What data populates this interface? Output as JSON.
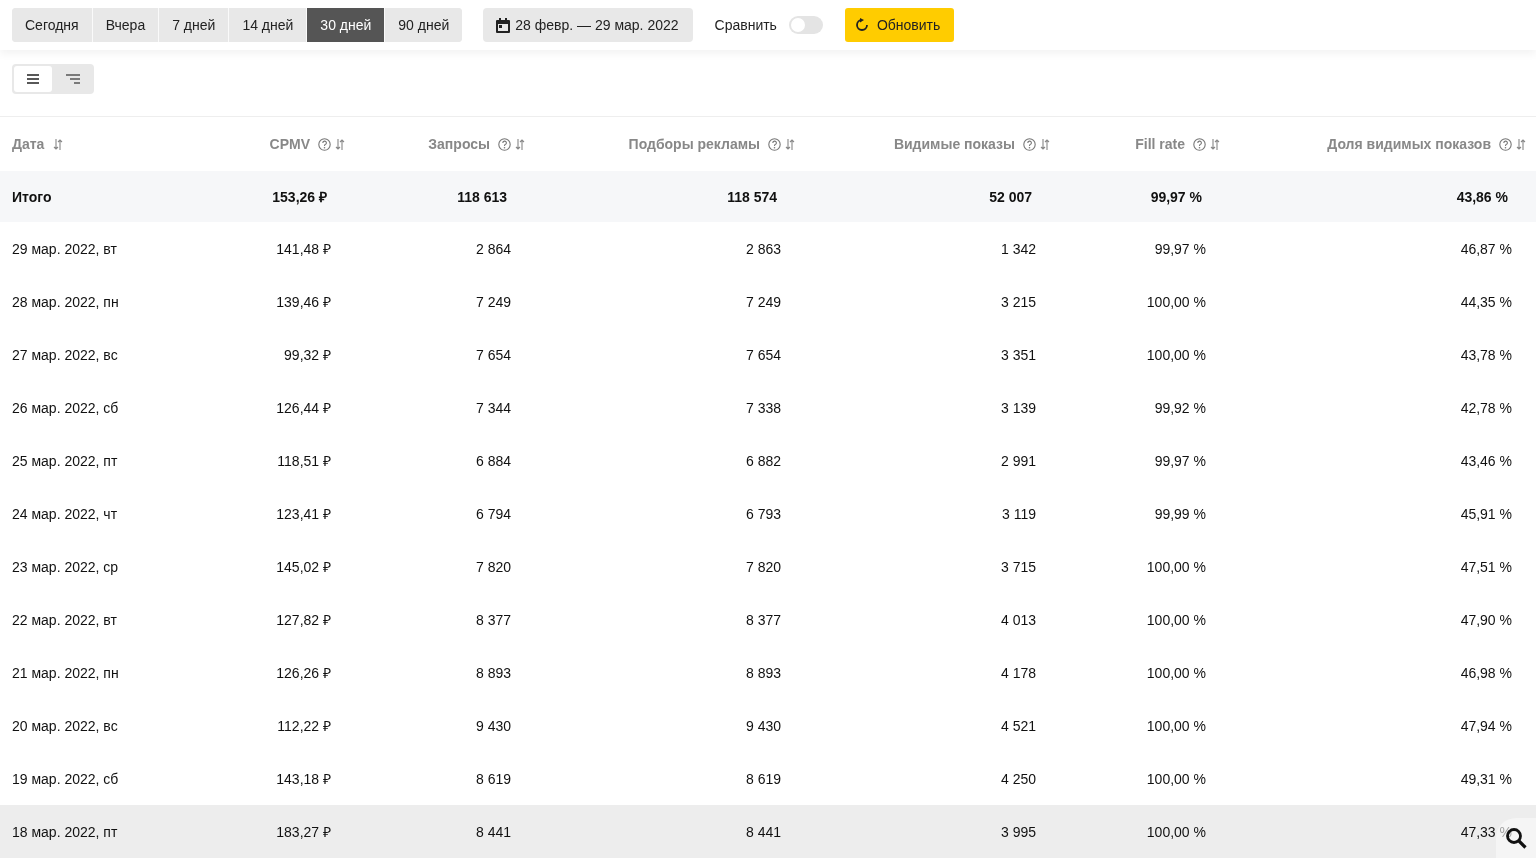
{
  "periods": [
    {
      "label": "Сегодня",
      "selected": false
    },
    {
      "label": "Вчера",
      "selected": false
    },
    {
      "label": "7 дней",
      "selected": false
    },
    {
      "label": "14 дней",
      "selected": false
    },
    {
      "label": "30 дней",
      "selected": true
    },
    {
      "label": "90 дней",
      "selected": false
    }
  ],
  "date_range": "28 февр. — 29 мар. 2022",
  "compare": {
    "label": "Сравнить",
    "on": false
  },
  "refresh_button": "Обновить",
  "view_toggle": [
    {
      "kind": "list",
      "selected": true
    },
    {
      "kind": "tree",
      "selected": false
    }
  ],
  "table": {
    "columns": [
      {
        "label": "Дата",
        "help": false
      },
      {
        "label": "CPMV",
        "help": true
      },
      {
        "label": "Запросы",
        "help": true
      },
      {
        "label": "Подборы рекламы",
        "help": true
      },
      {
        "label": "Видимые показы",
        "help": true
      },
      {
        "label": "Fill rate",
        "help": true
      },
      {
        "label": "Доля видимых показов",
        "help": true
      }
    ],
    "total": [
      "Итого",
      "153,26 ₽",
      "118 613",
      "118 574",
      "52 007",
      "99,97 %",
      "43,86 %"
    ],
    "rows": [
      {
        "selected": false,
        "cells": [
          "29 мар. 2022, вт",
          "141,48 ₽",
          "2 864",
          "2 863",
          "1 342",
          "99,97 %",
          "46,87 %"
        ]
      },
      {
        "selected": false,
        "cells": [
          "28 мар. 2022, пн",
          "139,46 ₽",
          "7 249",
          "7 249",
          "3 215",
          "100,00 %",
          "44,35 %"
        ]
      },
      {
        "selected": false,
        "cells": [
          "27 мар. 2022, вс",
          "99,32 ₽",
          "7 654",
          "7 654",
          "3 351",
          "100,00 %",
          "43,78 %"
        ]
      },
      {
        "selected": false,
        "cells": [
          "26 мар. 2022, сб",
          "126,44 ₽",
          "7 344",
          "7 338",
          "3 139",
          "99,92 %",
          "42,78 %"
        ]
      },
      {
        "selected": false,
        "cells": [
          "25 мар. 2022, пт",
          "118,51 ₽",
          "6 884",
          "6 882",
          "2 991",
          "99,97 %",
          "43,46 %"
        ]
      },
      {
        "selected": false,
        "cells": [
          "24 мар. 2022, чт",
          "123,41 ₽",
          "6 794",
          "6 793",
          "3 119",
          "99,99 %",
          "45,91 %"
        ]
      },
      {
        "selected": false,
        "cells": [
          "23 мар. 2022, ср",
          "145,02 ₽",
          "7 820",
          "7 820",
          "3 715",
          "100,00 %",
          "47,51 %"
        ]
      },
      {
        "selected": false,
        "cells": [
          "22 мар. 2022, вт",
          "127,82 ₽",
          "8 377",
          "8 377",
          "4 013",
          "100,00 %",
          "47,90 %"
        ]
      },
      {
        "selected": false,
        "cells": [
          "21 мар. 2022, пн",
          "126,26 ₽",
          "8 893",
          "8 893",
          "4 178",
          "100,00 %",
          "46,98 %"
        ]
      },
      {
        "selected": false,
        "cells": [
          "20 мар. 2022, вс",
          "112,22 ₽",
          "9 430",
          "9 430",
          "4 521",
          "100,00 %",
          "47,94 %"
        ]
      },
      {
        "selected": false,
        "cells": [
          "19 мар. 2022, сб",
          "143,18 ₽",
          "8 619",
          "8 619",
          "4 250",
          "100,00 %",
          "49,31 %"
        ]
      },
      {
        "selected": true,
        "cells": [
          "18 мар. 2022, пт",
          "183,27 ₽",
          "8 441",
          "8 441",
          "3 995",
          "100,00 %",
          "47,33 %"
        ]
      }
    ]
  }
}
